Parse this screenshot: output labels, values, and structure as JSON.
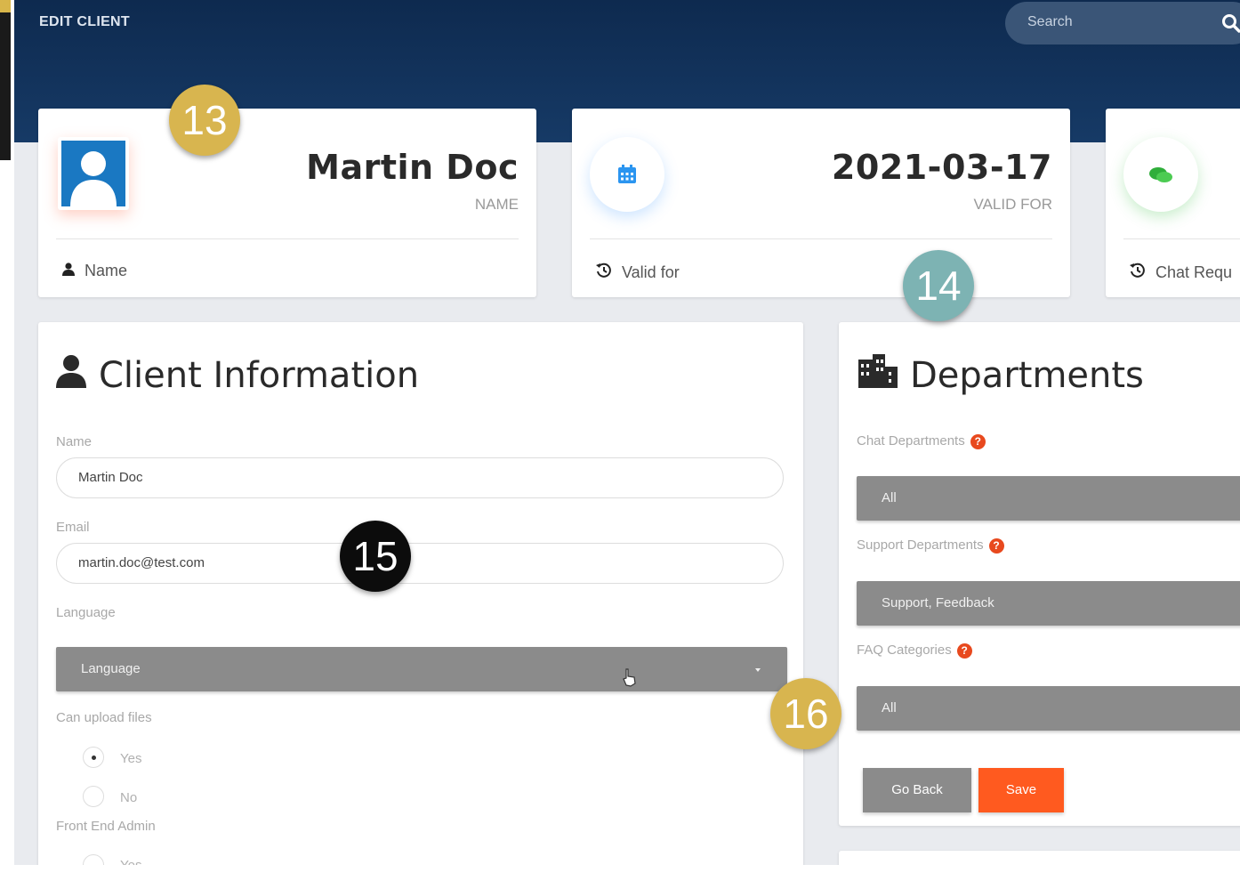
{
  "header": {
    "title": "EDIT CLIENT",
    "search_placeholder": "Search"
  },
  "stats": [
    {
      "value": "Martin Doc",
      "label": "NAME",
      "footer": "Name",
      "icon": "user-avatar-icon"
    },
    {
      "value": "2021-03-17",
      "label": "VALID FOR",
      "footer": "Valid for",
      "icon": "calendar-icon"
    },
    {
      "value": "",
      "label": "",
      "footer": "Chat Requ",
      "icon": "chat-bubbles-icon"
    }
  ],
  "client_info": {
    "title": "Client Information",
    "name_label": "Name",
    "name_value": "Martin Doc",
    "email_label": "Email",
    "email_value": "martin.doc@test.com",
    "language_label": "Language",
    "language_value": "Language",
    "upload_label": "Can upload files",
    "upload_yes": "Yes",
    "upload_no": "No",
    "upload_selected": "Yes",
    "frontend_label": "Front End Admin",
    "frontend_yes": "Yes"
  },
  "departments": {
    "title": "Departments",
    "chat_label": "Chat Departments",
    "chat_value": "All",
    "support_label": "Support Departments",
    "support_value": "Support, Feedback",
    "faq_label": "FAQ Categories",
    "faq_value": "All",
    "go_back": "Go Back",
    "save": "Save"
  },
  "annotations": [
    "13",
    "14",
    "15",
    "16"
  ],
  "colors": {
    "header": "#0e2a4f",
    "save": "#ff5a1f",
    "go_back": "#8b8b8b",
    "help": "#e8491e",
    "badge_gold": "#d8b54f",
    "badge_teal": "#7db3b3",
    "badge_black": "#0c0c0c"
  }
}
